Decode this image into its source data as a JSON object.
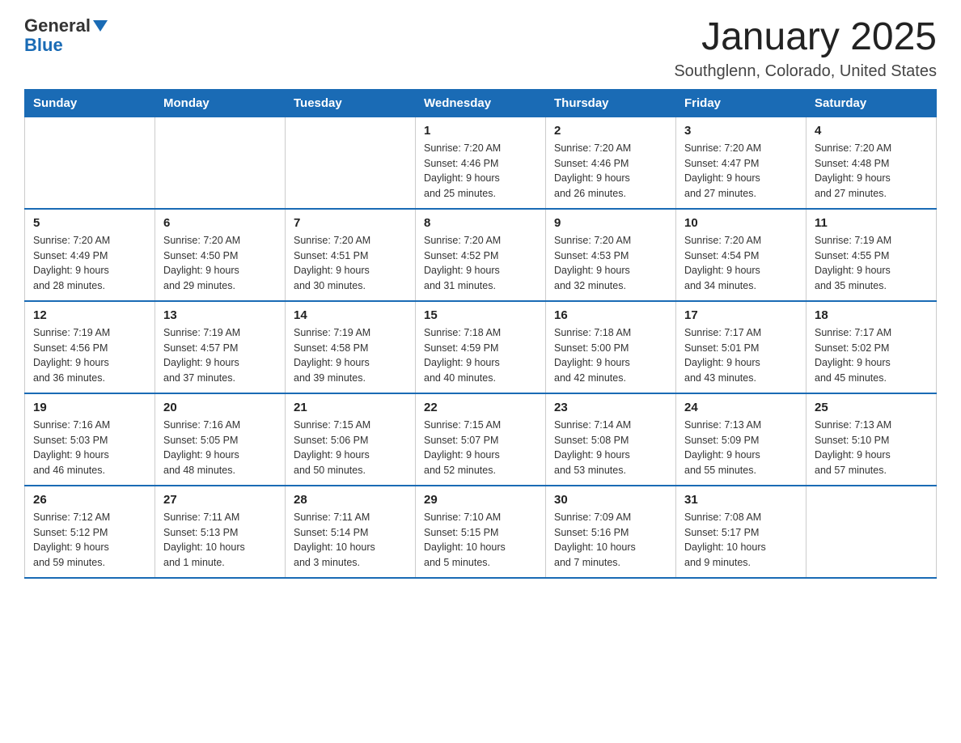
{
  "header": {
    "logo_general": "General",
    "logo_blue": "Blue",
    "title": "January 2025",
    "subtitle": "Southglenn, Colorado, United States"
  },
  "days_of_week": [
    "Sunday",
    "Monday",
    "Tuesday",
    "Wednesday",
    "Thursday",
    "Friday",
    "Saturday"
  ],
  "weeks": [
    [
      {
        "day": "",
        "info": ""
      },
      {
        "day": "",
        "info": ""
      },
      {
        "day": "",
        "info": ""
      },
      {
        "day": "1",
        "info": "Sunrise: 7:20 AM\nSunset: 4:46 PM\nDaylight: 9 hours\nand 25 minutes."
      },
      {
        "day": "2",
        "info": "Sunrise: 7:20 AM\nSunset: 4:46 PM\nDaylight: 9 hours\nand 26 minutes."
      },
      {
        "day": "3",
        "info": "Sunrise: 7:20 AM\nSunset: 4:47 PM\nDaylight: 9 hours\nand 27 minutes."
      },
      {
        "day": "4",
        "info": "Sunrise: 7:20 AM\nSunset: 4:48 PM\nDaylight: 9 hours\nand 27 minutes."
      }
    ],
    [
      {
        "day": "5",
        "info": "Sunrise: 7:20 AM\nSunset: 4:49 PM\nDaylight: 9 hours\nand 28 minutes."
      },
      {
        "day": "6",
        "info": "Sunrise: 7:20 AM\nSunset: 4:50 PM\nDaylight: 9 hours\nand 29 minutes."
      },
      {
        "day": "7",
        "info": "Sunrise: 7:20 AM\nSunset: 4:51 PM\nDaylight: 9 hours\nand 30 minutes."
      },
      {
        "day": "8",
        "info": "Sunrise: 7:20 AM\nSunset: 4:52 PM\nDaylight: 9 hours\nand 31 minutes."
      },
      {
        "day": "9",
        "info": "Sunrise: 7:20 AM\nSunset: 4:53 PM\nDaylight: 9 hours\nand 32 minutes."
      },
      {
        "day": "10",
        "info": "Sunrise: 7:20 AM\nSunset: 4:54 PM\nDaylight: 9 hours\nand 34 minutes."
      },
      {
        "day": "11",
        "info": "Sunrise: 7:19 AM\nSunset: 4:55 PM\nDaylight: 9 hours\nand 35 minutes."
      }
    ],
    [
      {
        "day": "12",
        "info": "Sunrise: 7:19 AM\nSunset: 4:56 PM\nDaylight: 9 hours\nand 36 minutes."
      },
      {
        "day": "13",
        "info": "Sunrise: 7:19 AM\nSunset: 4:57 PM\nDaylight: 9 hours\nand 37 minutes."
      },
      {
        "day": "14",
        "info": "Sunrise: 7:19 AM\nSunset: 4:58 PM\nDaylight: 9 hours\nand 39 minutes."
      },
      {
        "day": "15",
        "info": "Sunrise: 7:18 AM\nSunset: 4:59 PM\nDaylight: 9 hours\nand 40 minutes."
      },
      {
        "day": "16",
        "info": "Sunrise: 7:18 AM\nSunset: 5:00 PM\nDaylight: 9 hours\nand 42 minutes."
      },
      {
        "day": "17",
        "info": "Sunrise: 7:17 AM\nSunset: 5:01 PM\nDaylight: 9 hours\nand 43 minutes."
      },
      {
        "day": "18",
        "info": "Sunrise: 7:17 AM\nSunset: 5:02 PM\nDaylight: 9 hours\nand 45 minutes."
      }
    ],
    [
      {
        "day": "19",
        "info": "Sunrise: 7:16 AM\nSunset: 5:03 PM\nDaylight: 9 hours\nand 46 minutes."
      },
      {
        "day": "20",
        "info": "Sunrise: 7:16 AM\nSunset: 5:05 PM\nDaylight: 9 hours\nand 48 minutes."
      },
      {
        "day": "21",
        "info": "Sunrise: 7:15 AM\nSunset: 5:06 PM\nDaylight: 9 hours\nand 50 minutes."
      },
      {
        "day": "22",
        "info": "Sunrise: 7:15 AM\nSunset: 5:07 PM\nDaylight: 9 hours\nand 52 minutes."
      },
      {
        "day": "23",
        "info": "Sunrise: 7:14 AM\nSunset: 5:08 PM\nDaylight: 9 hours\nand 53 minutes."
      },
      {
        "day": "24",
        "info": "Sunrise: 7:13 AM\nSunset: 5:09 PM\nDaylight: 9 hours\nand 55 minutes."
      },
      {
        "day": "25",
        "info": "Sunrise: 7:13 AM\nSunset: 5:10 PM\nDaylight: 9 hours\nand 57 minutes."
      }
    ],
    [
      {
        "day": "26",
        "info": "Sunrise: 7:12 AM\nSunset: 5:12 PM\nDaylight: 9 hours\nand 59 minutes."
      },
      {
        "day": "27",
        "info": "Sunrise: 7:11 AM\nSunset: 5:13 PM\nDaylight: 10 hours\nand 1 minute."
      },
      {
        "day": "28",
        "info": "Sunrise: 7:11 AM\nSunset: 5:14 PM\nDaylight: 10 hours\nand 3 minutes."
      },
      {
        "day": "29",
        "info": "Sunrise: 7:10 AM\nSunset: 5:15 PM\nDaylight: 10 hours\nand 5 minutes."
      },
      {
        "day": "30",
        "info": "Sunrise: 7:09 AM\nSunset: 5:16 PM\nDaylight: 10 hours\nand 7 minutes."
      },
      {
        "day": "31",
        "info": "Sunrise: 7:08 AM\nSunset: 5:17 PM\nDaylight: 10 hours\nand 9 minutes."
      },
      {
        "day": "",
        "info": ""
      }
    ]
  ]
}
